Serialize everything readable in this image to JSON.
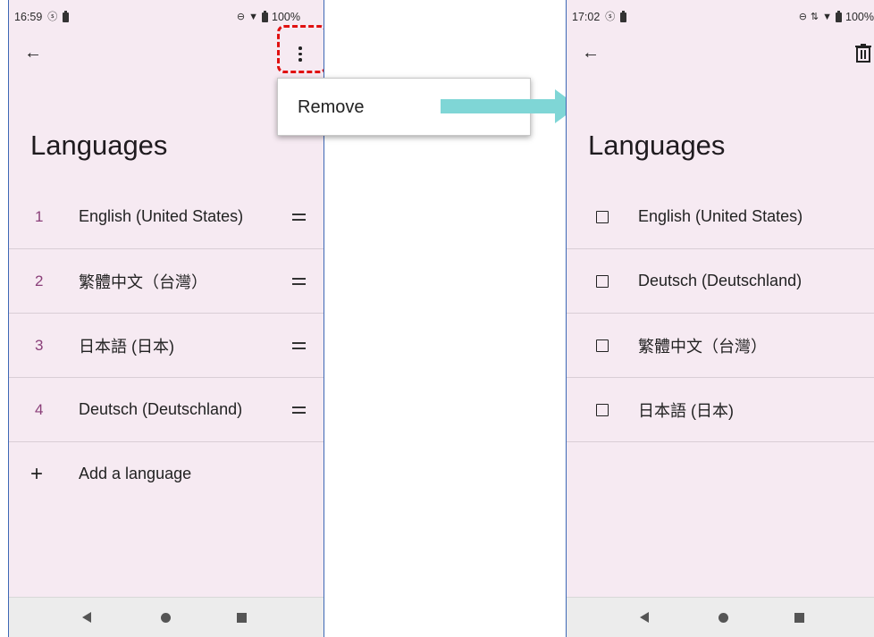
{
  "left_screen": {
    "status": {
      "time": "16:59",
      "battery": "100%"
    },
    "title": "Languages",
    "languages": [
      {
        "num": "1",
        "label": "English (United States)"
      },
      {
        "num": "2",
        "label": "繁體中文（台灣）"
      },
      {
        "num": "3",
        "label": "日本語 (日本)"
      },
      {
        "num": "4",
        "label": "Deutsch (Deutschland)"
      }
    ],
    "add_label": "Add a language"
  },
  "popup_menu": {
    "item": "Remove"
  },
  "right_screen": {
    "status": {
      "time": "17:02",
      "battery": "100%"
    },
    "title": "Languages",
    "languages": [
      "English (United States)",
      "Deutsch (Deutschland)",
      "繁體中文（台灣）",
      "日本語 (日本)"
    ]
  },
  "colors": {
    "background": "#f6eaf2",
    "accent_number": "#8a3f79",
    "highlight": "#e01010",
    "arrow": "#7fd6d6"
  },
  "icons": [
    "back-arrow-icon",
    "more-vert-icon",
    "drag-handle-icon",
    "add-icon",
    "delete-icon",
    "checkbox-icon",
    "nav-back-icon",
    "nav-home-icon",
    "nav-recents-icon"
  ]
}
